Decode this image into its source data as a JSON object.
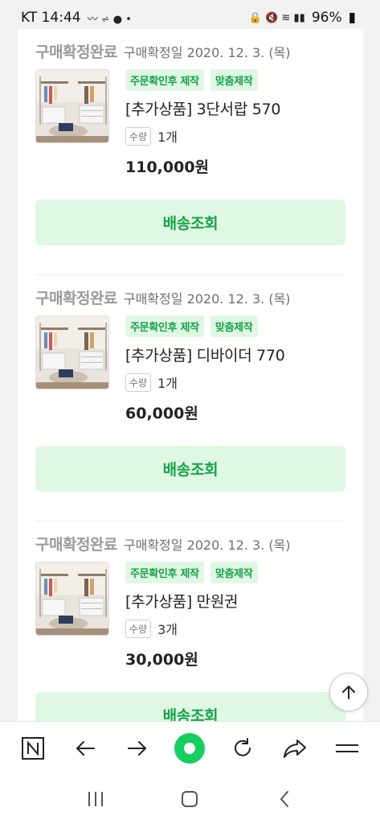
{
  "status_bar": {
    "carrier_time": "KT 14:44",
    "battery": "96%"
  },
  "orders": [
    {
      "status": "구매확정완료",
      "date": "구매확정일 2020. 12. 3. (목)",
      "badges": [
        "주문확인후 제작",
        "맞춤제작"
      ],
      "name": "[추가상품] 3단서랍 570",
      "qty_label": "수량",
      "qty": "1개",
      "price": "110,000원",
      "button": "배송조회"
    },
    {
      "status": "구매확정완료",
      "date": "구매확정일 2020. 12. 3. (목)",
      "badges": [
        "주문확인후 제작",
        "맞춤제작"
      ],
      "name": "[추가상품] 디바이더 770",
      "qty_label": "수량",
      "qty": "1개",
      "price": "60,000원",
      "button": "배송조회"
    },
    {
      "status": "구매확정완료",
      "date": "구매확정일 2020. 12. 3. (목)",
      "badges": [
        "주문확인후 제작",
        "맞춤제작"
      ],
      "name": "[추가상품] 만원권",
      "qty_label": "수량",
      "qty": "3개",
      "price": "30,000원",
      "button": "배송조회"
    }
  ],
  "toolbar": {
    "icons": [
      "naver-n-icon",
      "back-arrow-icon",
      "forward-arrow-icon",
      "green-dot-home-icon",
      "refresh-icon",
      "share-icon",
      "menu-icon"
    ]
  },
  "colors": {
    "accent_green": "#17a34a",
    "badge_bg": "#e0f7e4",
    "button_bg": "#dff8e3"
  }
}
